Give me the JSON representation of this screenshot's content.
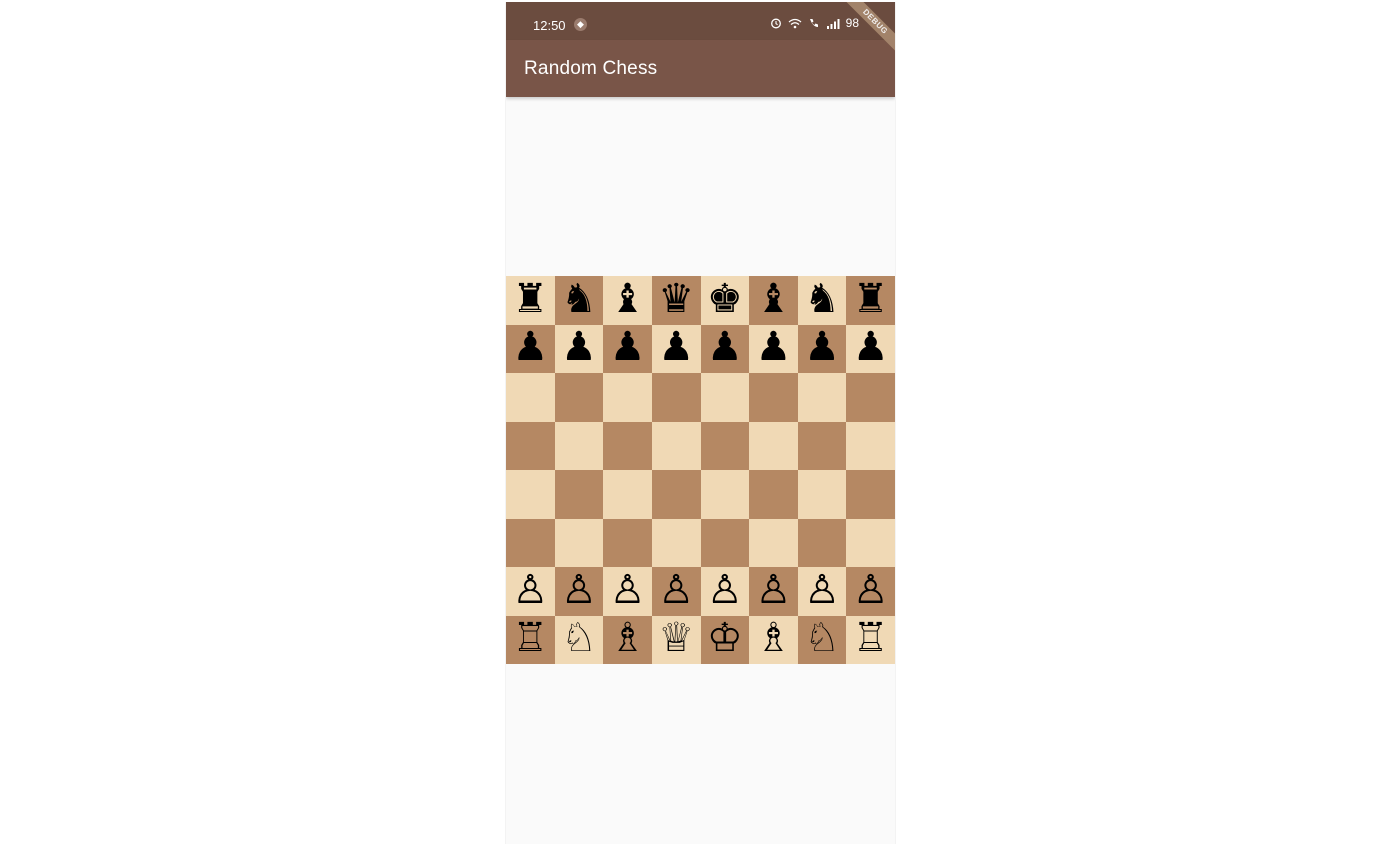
{
  "status_bar": {
    "time": "12:50"
  },
  "app_bar": {
    "title": "Random Chess",
    "debug_banner": "DEBUG"
  },
  "colors": {
    "light_square": "#f0d9b5",
    "dark_square": "#b58863",
    "app_bar": "#795548",
    "status_bar": "#6b4c3f"
  },
  "board": {
    "rows": [
      [
        "♜",
        "♞",
        "♝",
        "♛",
        "♚",
        "♝",
        "♞",
        "♜"
      ],
      [
        "♟",
        "♟",
        "♟",
        "♟",
        "♟",
        "♟",
        "♟",
        "♟"
      ],
      [
        "",
        "",
        "",
        "",
        "",
        "",
        "",
        ""
      ],
      [
        "",
        "",
        "",
        "",
        "",
        "",
        "",
        ""
      ],
      [
        "",
        "",
        "",
        "",
        "",
        "",
        "",
        ""
      ],
      [
        "",
        "",
        "",
        "",
        "",
        "",
        "",
        ""
      ],
      [
        "♙",
        "♙",
        "♙",
        "♙",
        "♙",
        "♙",
        "♙",
        "♙"
      ],
      [
        "♖",
        "♘",
        "♗",
        "♕",
        "♔",
        "♗",
        "♘",
        "♖"
      ]
    ],
    "piece_names": [
      [
        "black-rook",
        "black-knight",
        "black-bishop",
        "black-queen",
        "black-king",
        "black-bishop",
        "black-knight",
        "black-rook"
      ],
      [
        "black-pawn",
        "black-pawn",
        "black-pawn",
        "black-pawn",
        "black-pawn",
        "black-pawn",
        "black-pawn",
        "black-pawn"
      ],
      [
        "",
        "",
        "",
        "",
        "",
        "",
        "",
        ""
      ],
      [
        "",
        "",
        "",
        "",
        "",
        "",
        "",
        ""
      ],
      [
        "",
        "",
        "",
        "",
        "",
        "",
        "",
        ""
      ],
      [
        "",
        "",
        "",
        "",
        "",
        "",
        "",
        ""
      ],
      [
        "white-pawn",
        "white-pawn",
        "white-pawn",
        "white-pawn",
        "white-pawn",
        "white-pawn",
        "white-pawn",
        "white-pawn"
      ],
      [
        "white-rook",
        "white-knight",
        "white-bishop",
        "white-queen",
        "white-king",
        "white-bishop",
        "white-knight",
        "white-rook"
      ]
    ]
  }
}
